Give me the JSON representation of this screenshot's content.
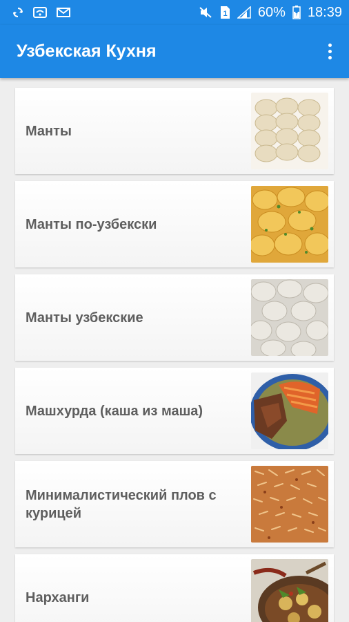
{
  "status_bar": {
    "battery": "60%",
    "time": "18:39",
    "icons_left": [
      "sync-icon",
      "wifi-signal-icon",
      "mail-icon"
    ],
    "icons_right": [
      "mute-icon",
      "sim-icon",
      "signal-icon",
      "battery-icon"
    ]
  },
  "app_bar": {
    "title": "Узбекская Кухня",
    "menu_icon": "more-vert-icon"
  },
  "recipes": [
    {
      "title": "Манты",
      "thumb": "manty-image"
    },
    {
      "title": "Манты по-узбекски",
      "thumb": "manty-uzbek-image"
    },
    {
      "title": "Манты узбекские",
      "thumb": "manty-uzbekskie-image"
    },
    {
      "title": "Машхурда (каша из маша)",
      "thumb": "mashkhurda-image"
    },
    {
      "title": "Минималистический плов с курицей",
      "thumb": "plov-image"
    },
    {
      "title": "Нарханги",
      "thumb": "narkhangi-image"
    }
  ],
  "colors": {
    "primary": "#1e88e5",
    "background": "#eeeeee",
    "card_text": "#5e5e5e"
  }
}
